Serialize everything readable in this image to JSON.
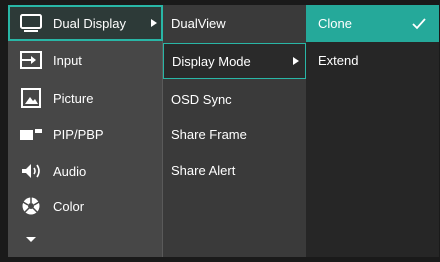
{
  "menu": {
    "items": [
      {
        "label": "Dual Display",
        "icon": "dual-display-icon"
      },
      {
        "label": "Input",
        "icon": "input-icon"
      },
      {
        "label": "Picture",
        "icon": "picture-icon"
      },
      {
        "label": "PIP/PBP",
        "icon": "pip-pbp-icon"
      },
      {
        "label": "Audio",
        "icon": "audio-icon"
      },
      {
        "label": "Color",
        "icon": "color-icon"
      }
    ],
    "more_icon": "chevron-down-icon"
  },
  "submenu": {
    "items": [
      {
        "label": "DualView"
      },
      {
        "label": "Display Mode"
      },
      {
        "label": "OSD Sync"
      },
      {
        "label": "Share Frame"
      },
      {
        "label": "Share Alert"
      }
    ]
  },
  "options": {
    "items": [
      {
        "label": "Clone",
        "selected": true
      },
      {
        "label": "Extend",
        "selected": false
      }
    ]
  },
  "colors": {
    "accent": "#29b6a6",
    "selected_fill": "#25a99a"
  }
}
